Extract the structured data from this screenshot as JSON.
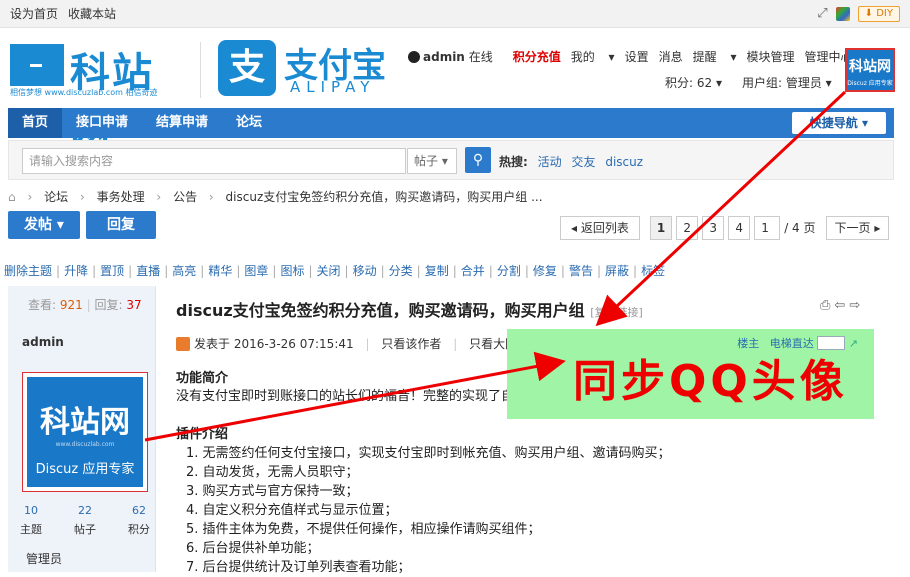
{
  "topbar": {
    "set_home": "设为首页",
    "bookmark": "收藏本站",
    "diy": "DIY"
  },
  "logo": {
    "site_name": "科站网",
    "tagline": "相信梦想 www.discuzlab.com 相信奇迹",
    "alipay_cn": "支付宝",
    "alipay_en": "ALIPAY",
    "alipay_icon": "支"
  },
  "user": {
    "name": "admin",
    "online": "在线",
    "recharge": "积分充值",
    "mine": "我的",
    "settings": "设置",
    "messages": "消息",
    "reminders": "提醒",
    "modules": "模块管理",
    "admincp": "管理中心",
    "credits": "积分: 62",
    "group": "用户组: 管理员"
  },
  "avatar_small": {
    "text": "科站网",
    "sub": "Discuz 应用专家"
  },
  "nav": {
    "items": [
      "首页",
      "接口申请",
      "结算申请",
      "论坛"
    ],
    "quick": "快捷导航 ▾"
  },
  "search": {
    "placeholder": "请输入搜索内容",
    "type": "帖子",
    "hot_label": "热搜:",
    "hot": [
      "活动",
      "交友",
      "discuz"
    ]
  },
  "breadcrumb": [
    "⌂",
    "›",
    "论坛",
    "›",
    "事务处理",
    "›",
    "公告",
    "›",
    "discuz支付宝免签约积分充值，购买邀请码，购买用户组 ..."
  ],
  "buttons": {
    "post": "发帖 ▾",
    "reply": "回复"
  },
  "pager": {
    "back": "◂ 返回列表",
    "pages": [
      "1",
      "2",
      "3",
      "4"
    ],
    "input": "1",
    "total": "/ 4 页",
    "next": "下一页 ▸"
  },
  "admin_tools": [
    "删除主题",
    "升降",
    "置顶",
    "直播",
    "高亮",
    "精华",
    "图章",
    "图标",
    "关闭",
    "移动",
    "分类",
    "复制",
    "合并",
    "分割",
    "修复",
    "警告",
    "屏蔽",
    "标签"
  ],
  "author": {
    "views_label": "查看:",
    "views": "921",
    "replies_label": "回复:",
    "replies": "37",
    "name": "admin",
    "avatar_title": "科站网",
    "avatar_url": "www.discuzlab.com",
    "avatar_sub": "Discuz 应用专家",
    "threads": "10",
    "threads_label": "主题",
    "posts": "22",
    "posts_label": "帖子",
    "credits": "62",
    "credits_label": "积分",
    "role": "管理员"
  },
  "post": {
    "title": "discuz支付宝免签约积分充值，购买邀请码，购买用户组",
    "copy_link": "[复制链接]",
    "posted_at": "发表于 2016-3-26 07:15:41",
    "only_author": "只看该作者",
    "big_image": "只看大图 ▸",
    "floor": "楼主",
    "elevator": "电梯直达",
    "annotation": "同步QQ头像",
    "section1": "功能简介",
    "intro": "没有支付宝即时到账接口的站长们的福音！完整的实现了自带的商务功能，无需支付任何费用成本！",
    "section2": "插件介绍",
    "features": [
      "1. 无需签约任何支付宝接口，实现支付宝即时到帐充值、购买用户组、邀请码购买；",
      "2. 自动发货，无需人员职守；",
      "3. 购买方式与官方保持一致；",
      "4. 自定义积分充值样式与显示位置；",
      "5. 插件主体为免费，不提供任何操作，相应操作请购买组件；",
      "6. 后台提供补单功能；",
      "7. 后台提供统计及订单列表查看功能；"
    ]
  },
  "colors": {
    "accent": "#2b7acc",
    "annotation": "#e00000",
    "highlight": "#9ff5a5"
  }
}
